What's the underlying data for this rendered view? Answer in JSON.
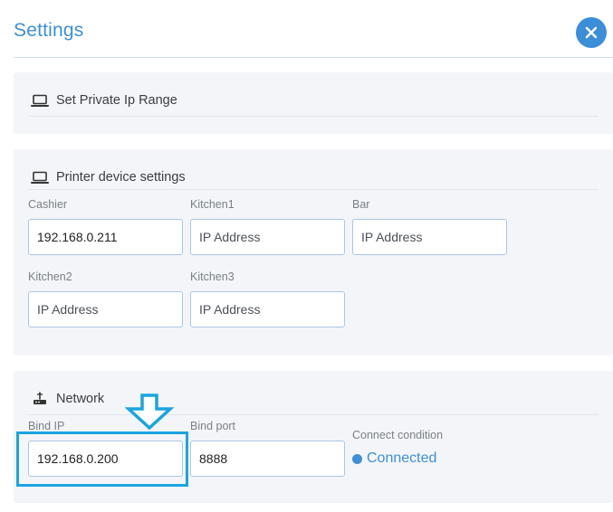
{
  "header": {
    "title": "Settings",
    "close_icon": "close-icon"
  },
  "private_ip_panel": {
    "title": "Set Private Ip Range",
    "icon": "laptop-icon"
  },
  "printer_panel": {
    "title": "Printer device settings",
    "icon": "laptop-icon",
    "fields": [
      {
        "label": "Cashier",
        "value": "192.168.0.211",
        "placeholder": "IP Address"
      },
      {
        "label": "Kitchen1",
        "value": "",
        "placeholder": "IP Address"
      },
      {
        "label": "Bar",
        "value": "",
        "placeholder": "IP Address"
      },
      {
        "label": "Kitchen2",
        "value": "",
        "placeholder": "IP Address"
      },
      {
        "label": "Kitchen3",
        "value": "",
        "placeholder": "IP Address"
      }
    ]
  },
  "network_panel": {
    "title": "Network",
    "icon": "router-icon",
    "bind_ip": {
      "label": "Bind IP",
      "value": "192.168.0.200"
    },
    "bind_port": {
      "label": "Bind port",
      "value": "8888"
    },
    "connect_condition": {
      "label": "Connect condition",
      "status": "Connected"
    }
  },
  "annotation": {
    "arrow_icon": "down-arrow-icon",
    "color": "#1aa5e0"
  },
  "colors": {
    "accent": "#3d8fd6",
    "panel_bg": "#f3f5f8",
    "input_border": "#aac7e4"
  }
}
